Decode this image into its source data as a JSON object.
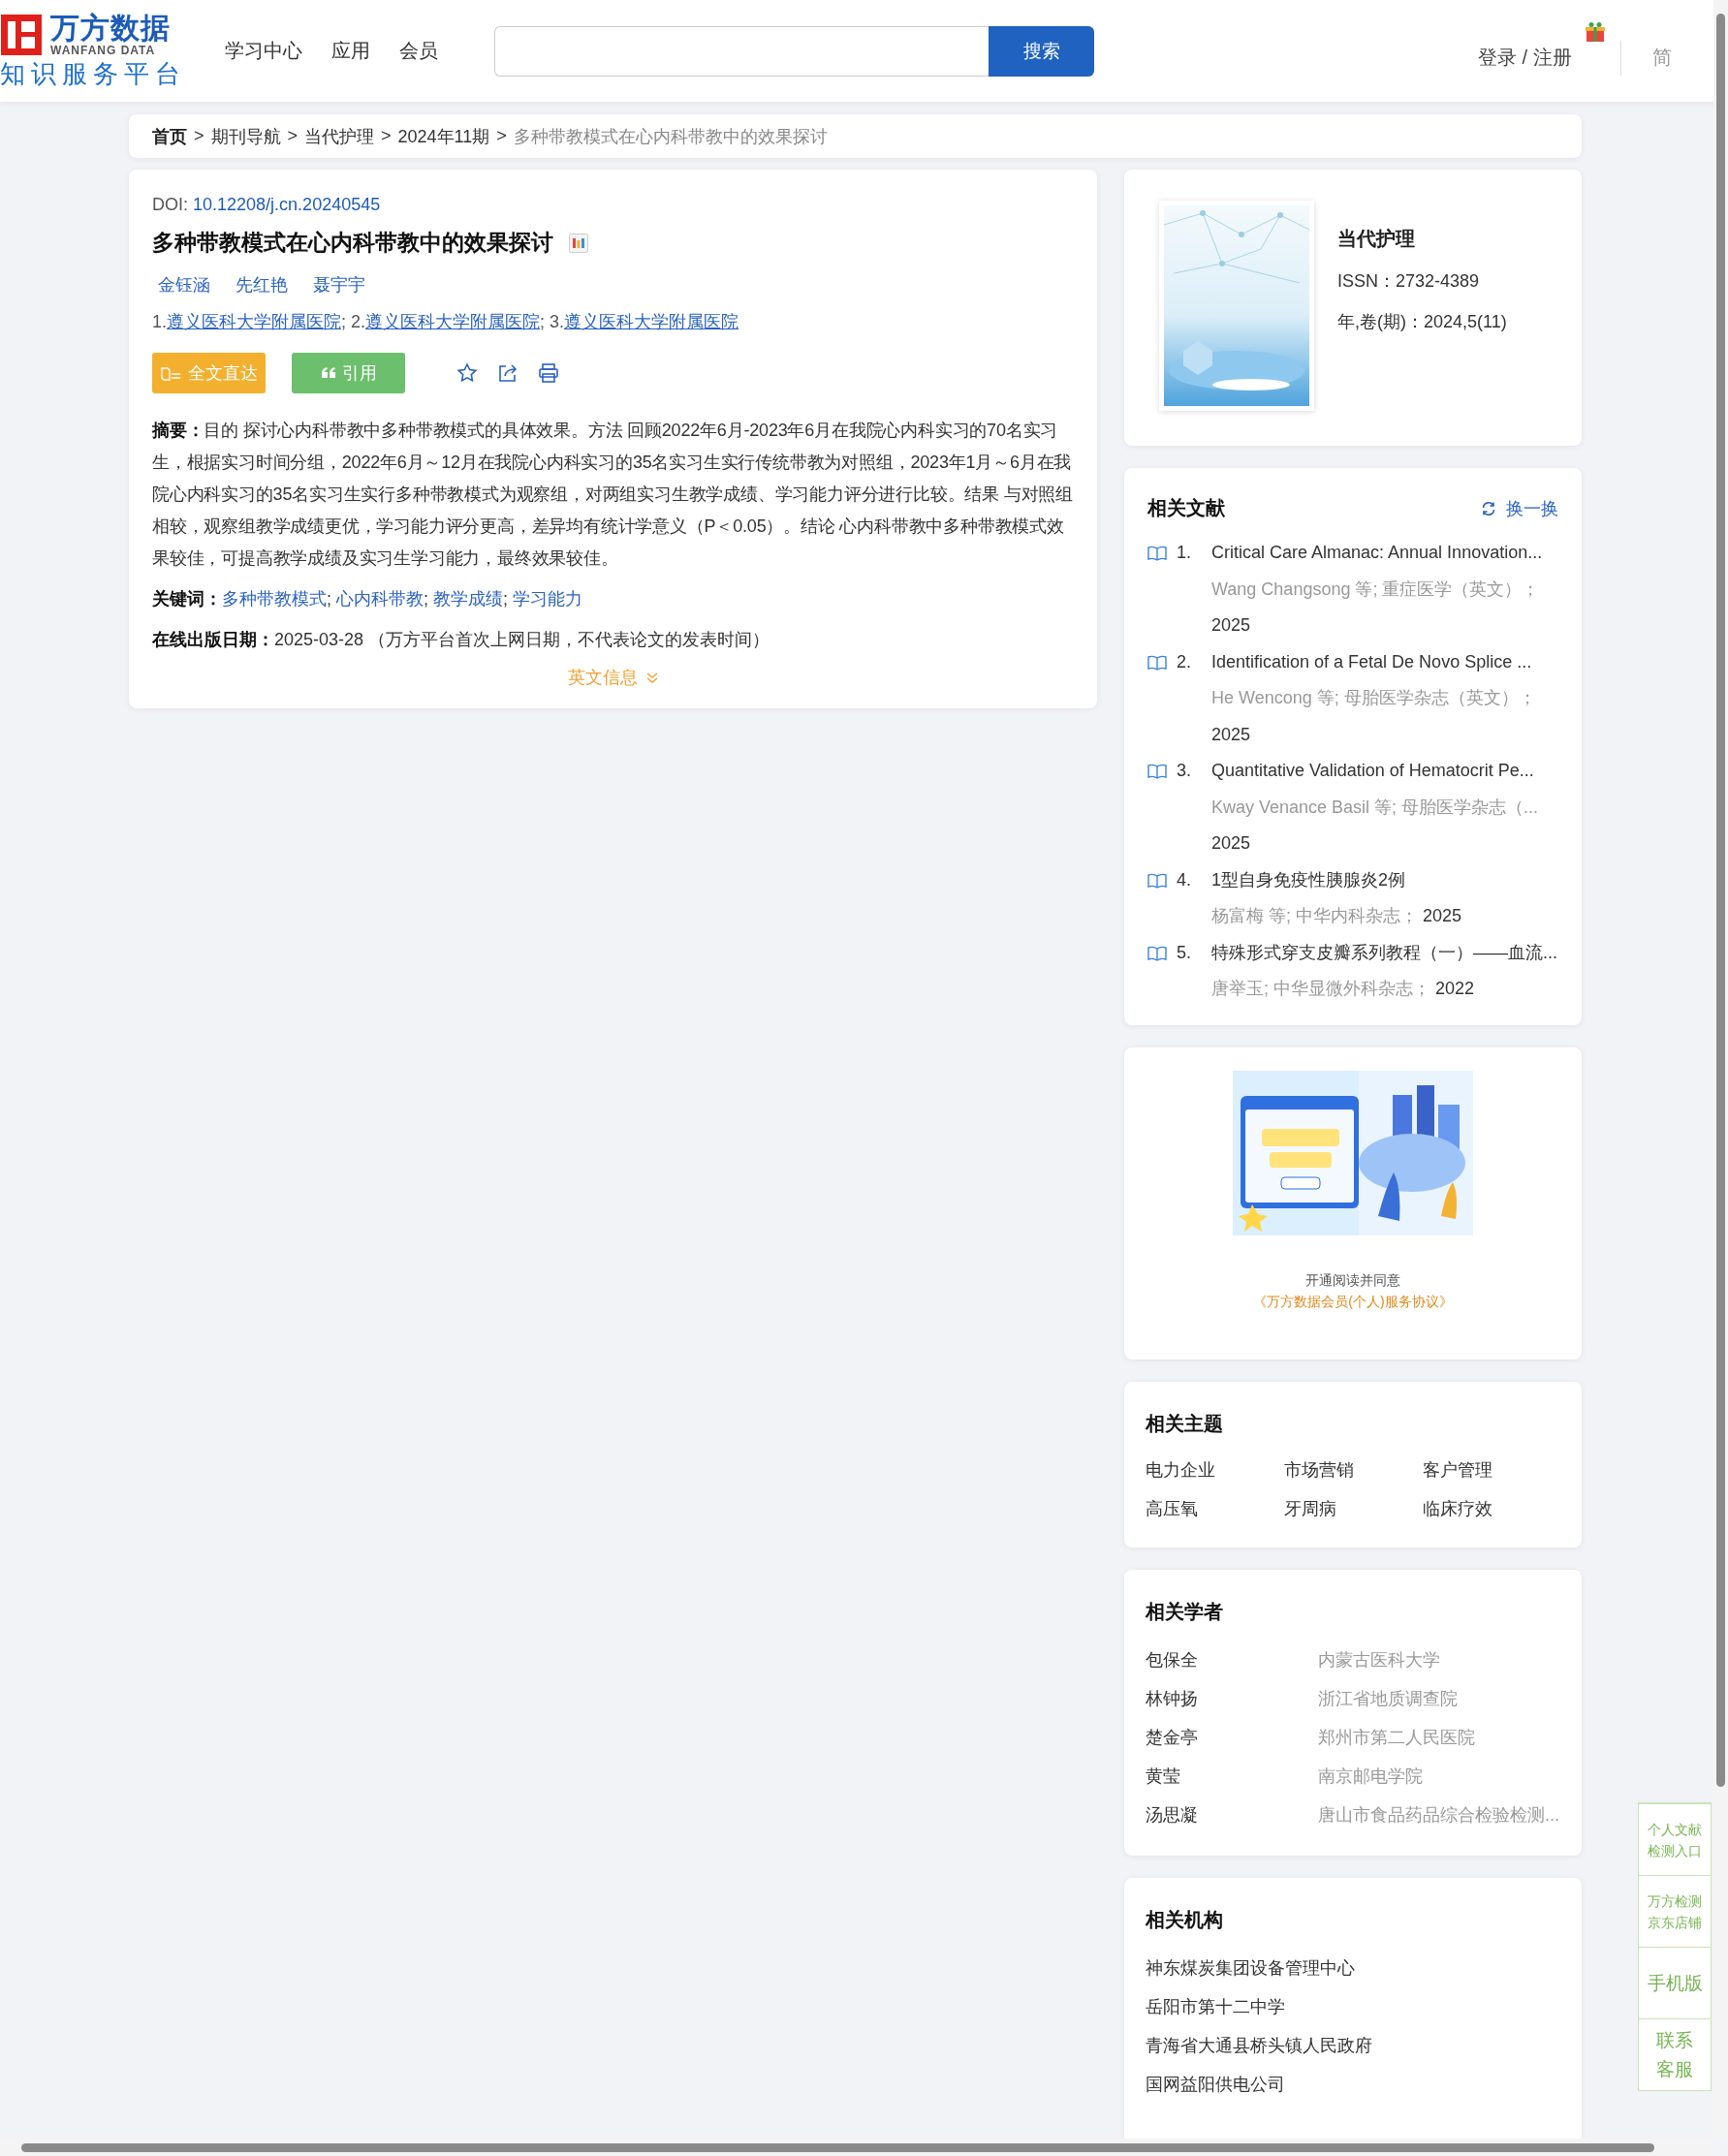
{
  "header": {
    "logo": {
      "title": "万方数据",
      "subtitle": "WANFANG DATA",
      "tagline": "知识服务平台"
    },
    "nav": [
      "学习中心",
      "应用",
      "会员"
    ],
    "search": {
      "button": "搜索"
    },
    "login": "登录 / 注册",
    "language": "简"
  },
  "breadcrumb": {
    "separator": ">",
    "items": [
      {
        "label": "首页",
        "kind": "home"
      },
      {
        "label": "期刊导航",
        "kind": "link"
      },
      {
        "label": "当代护理",
        "kind": "link"
      },
      {
        "label": "2024年11期",
        "kind": "link"
      },
      {
        "label": "多种带教模式在心内科带教中的效果探讨",
        "kind": "current"
      }
    ]
  },
  "article": {
    "doi_label": "DOI:",
    "doi": "10.12208/j.cn.20240545",
    "title": "多种带教模式在心内科带教中的效果探讨",
    "authors": [
      "金钰涵",
      "先红艳",
      "聂宇宇"
    ],
    "affiliations": [
      {
        "prefix": "1.",
        "name": "遵义医科大学附属医院"
      },
      {
        "prefix": "; 2.",
        "name": "遵义医科大学附属医院"
      },
      {
        "prefix": "; 3.",
        "name": "遵义医科大学附属医院"
      }
    ],
    "actions": [
      {
        "kind": "fulltext",
        "label": "全文直达"
      },
      {
        "kind": "cite",
        "label": "引用"
      }
    ],
    "abstract": "**摘要：**目的 探讨心内科带教中多种带教模式的具体效果。方法 回顾2022年6月-2023年6月在我院心内科实习的70名实习生，根据实习时间分组，2022年6月～12月在我院心内科实习的35名实习生实行传统带教为对照组，2023年1月～6月在我院心内科实习的35名实习生实行多种带教模式为观察组，对两组实习生教学成绩、学习能力评分进行比较。结果 与对照组相较，观察组教学成绩更优，学习能力评分更高，差异均有统计学意义（P＜0.05）。结论 心内科带教中多种带教模式效果较佳，可提高教学成绩及实习生学习能力，最终效果较佳。",
    "keywords": {
      "label": "关键词：",
      "separator": ";",
      "items": [
        "多种带教模式",
        "心内科带教",
        "教学成绩",
        "学习能力"
      ]
    },
    "online_date": "**在线出版日期：**2025-03-28 （万方平台首次上网日期，不代表论文的发表时间）",
    "english_toggle": "英文信息"
  },
  "journal": {
    "name": "当代护理",
    "issn": "ISSN：2732-4389",
    "volume": "年,卷(期)：2024,5(11)"
  },
  "related_literature": {
    "title": "相关文献",
    "refresh": "换一换",
    "items": [
      {
        "number": "1.",
        "title": "Critical Care Almanac: Annual Innovation...",
        "meta": "Wang Changsong  等;  重症医学（英文）；",
        "year": "2025"
      },
      {
        "number": "2.",
        "title": "Identification of a Fetal De Novo Splice ...",
        "meta": "He Wencong  等;  母胎医学杂志（英文）；",
        "year": "2025"
      },
      {
        "number": "3.",
        "title": "Quantitative Validation of Hematocrit Pe...",
        "meta": "Kway Venance Basil  等;  母胎医学杂志（...",
        "year": "2025"
      },
      {
        "number": "4.",
        "title": "1型自身免疫性胰腺炎2例",
        "meta": "杨富梅  等;  中华内科杂志；",
        "year": "2025"
      },
      {
        "number": "5.",
        "title": "特殊形式穿支皮瓣系列教程（一）——血流...",
        "meta": "唐举玉; 中华显微外科杂志；",
        "year": "2022"
      }
    ]
  },
  "promo": {
    "agree": "开通阅读并同意",
    "link": "《万方数据会员(个人)服务协议》"
  },
  "topics": {
    "title": "相关主题",
    "items": [
      "电力企业",
      "市场营销",
      "客户管理",
      "高压氧",
      "牙周病",
      "临床疗效"
    ]
  },
  "scholars": {
    "title": "相关学者",
    "items": [
      {
        "name": "包保全",
        "org": "内蒙古医科大学"
      },
      {
        "name": "林钟扬",
        "org": "浙江省地质调查院"
      },
      {
        "name": "楚金亭",
        "org": "郑州市第二人民医院"
      },
      {
        "name": "黄莹",
        "org": "南京邮电学院"
      },
      {
        "name": "汤思凝",
        "org": "唐山市食品药品综合检验检测..."
      }
    ]
  },
  "institutions": {
    "title": "相关机构",
    "items": [
      "神东煤炭集团设备管理中心",
      "岳阳市第十二中学",
      "青海省大通县桥头镇人民政府",
      "国网益阳供电公司"
    ]
  },
  "side_tools": [
    {
      "kind": "small",
      "label": "个人文献检测入口"
    },
    {
      "kind": "small",
      "label": "万方检测京东店铺"
    },
    {
      "kind": "large",
      "label": "手机版"
    },
    {
      "kind": "large",
      "label": "联系客服"
    }
  ]
}
